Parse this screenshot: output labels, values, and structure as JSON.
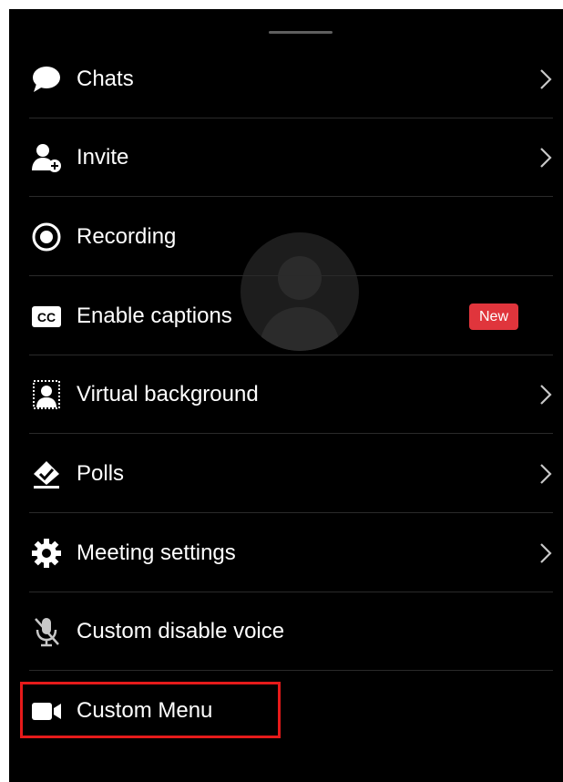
{
  "menu": {
    "items": [
      {
        "name": "chats",
        "label": "Chats",
        "icon": "chat-bubble-icon",
        "chevron": true
      },
      {
        "name": "invite",
        "label": "Invite",
        "icon": "add-user-icon",
        "chevron": true
      },
      {
        "name": "recording",
        "label": "Recording",
        "icon": "record-icon",
        "chevron": false
      },
      {
        "name": "enable-captions",
        "label": "Enable captions",
        "icon": "closed-captions-icon",
        "chevron": false,
        "badge": "New"
      },
      {
        "name": "virtual-background",
        "label": "Virtual background",
        "icon": "virtual-background-icon",
        "chevron": true
      },
      {
        "name": "polls",
        "label": "Polls",
        "icon": "poll-check-icon",
        "chevron": true
      },
      {
        "name": "meeting-settings",
        "label": "Meeting settings",
        "icon": "gear-icon",
        "chevron": true
      },
      {
        "name": "custom-disable-voice",
        "label": "Custom disable voice",
        "icon": "mic-off-icon",
        "chevron": false
      },
      {
        "name": "custom-menu",
        "label": "Custom Menu",
        "icon": "video-camera-icon",
        "chevron": false,
        "highlighted": true
      }
    ]
  },
  "colors": {
    "background": "#000000",
    "text": "#ffffff",
    "divider": "#2a2a2a",
    "badge": "#e0353c",
    "highlight": "#e61a1a"
  }
}
